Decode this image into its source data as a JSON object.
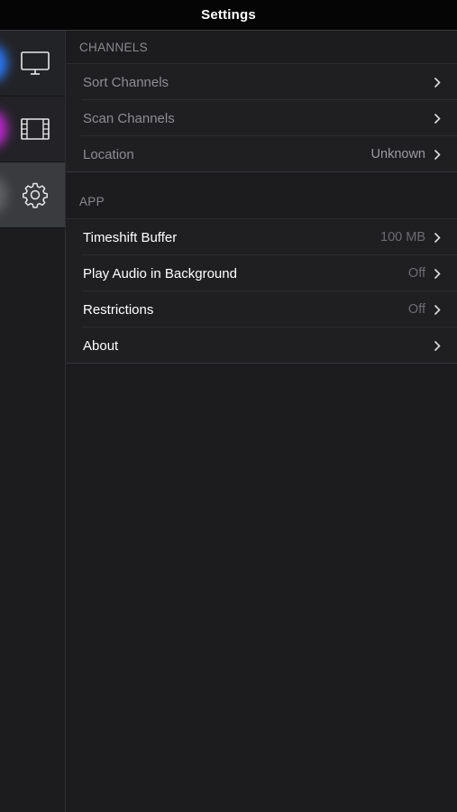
{
  "navbar": {
    "title": "Settings"
  },
  "sidebar": {
    "items": [
      {
        "name": "tv",
        "icon": "tv-icon",
        "glow": "#2a7bff"
      },
      {
        "name": "movies",
        "icon": "film-icon",
        "glow": "#c026d3"
      },
      {
        "name": "settings",
        "icon": "gear-icon",
        "selected": true
      }
    ]
  },
  "channels": {
    "header": "CHANNELS",
    "rows": [
      {
        "label": "Sort Channels",
        "value": ""
      },
      {
        "label": "Scan Channels",
        "value": ""
      },
      {
        "label": "Location",
        "value": "Unknown"
      }
    ]
  },
  "app": {
    "header": "APP",
    "rows": [
      {
        "label": "Timeshift Buffer",
        "value": "100 MB"
      },
      {
        "label": "Play Audio in Background",
        "value": "Off"
      },
      {
        "label": "Restrictions",
        "value": "Off"
      },
      {
        "label": "About",
        "value": ""
      }
    ]
  },
  "colors": {
    "background": "#1c1c1e",
    "navbar": "#050505",
    "accent_blue": "#2a7bff",
    "accent_purple": "#c026d3"
  }
}
